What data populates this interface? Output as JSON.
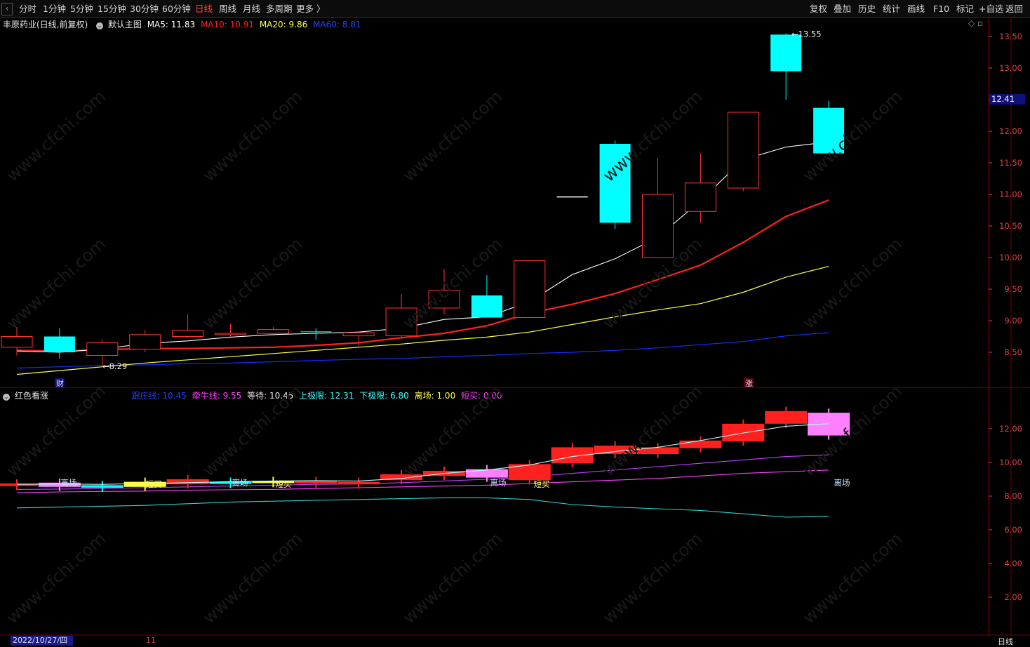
{
  "toolbar": {
    "periods": [
      "分时",
      "1分钟",
      "5分钟",
      "15分钟",
      "30分钟",
      "60分钟",
      "日线",
      "周线",
      "月线",
      "多周期",
      "更多 〉"
    ],
    "active_period": "日线",
    "right_buttons": [
      "复权",
      "叠加",
      "历史",
      "统计",
      "画线",
      "F10",
      "标记",
      "+自选",
      "返回"
    ]
  },
  "main_header": {
    "stock": "丰原药业(日线,前复权)",
    "template": "默认主图",
    "ma5": "MA5: 11.83",
    "ma10": "MA10: 10.91",
    "ma20": "MA20: 9.86",
    "ma60": "MA60: 8.81"
  },
  "sub_header": {
    "name": "红色看涨",
    "items": [
      "跟庄线: 10.45",
      "牵牛线: 9.55",
      "等待: 10.45",
      "上极限: 12.31",
      "下极限: 6.80",
      "离场: 1.00",
      "短买: 0.00"
    ]
  },
  "colors": {
    "up": "#ff3232",
    "down": "#00ffff",
    "ma5": "#ffffff",
    "ma10": "#ff2020",
    "ma20": "#ffff40",
    "ma60": "#1030ff",
    "grid": "#7a0000",
    "axis": "#e04040"
  },
  "main_axis_ticks": [
    "13.50",
    "13.00",
    "12.50",
    "12.00",
    "11.50",
    "11.00",
    "10.50",
    "10.00",
    "9.50",
    "9.00",
    "8.50"
  ],
  "sub_axis_ticks": [
    "12.00",
    "10.00",
    "8.00",
    "6.00",
    "4.00",
    "2.00"
  ],
  "price_tag": "12.41",
  "annotations": {
    "high": "13.55",
    "low": "8.29",
    "cai": "财",
    "zhang": "涨"
  },
  "sub_labels": {
    "lichang": "离场",
    "duanmai": "短买"
  },
  "footer": {
    "date": "2022/10/27/四",
    "mark": "11",
    "period": "日线"
  },
  "watermark": "www.cfchi.com",
  "chart_data": {
    "type": "candlestick",
    "candles": [
      {
        "o": 8.75,
        "h": 8.9,
        "l": 8.45,
        "c": 8.58,
        "u": true
      },
      {
        "o": 8.75,
        "h": 8.88,
        "l": 8.4,
        "c": 8.5,
        "u": false
      },
      {
        "o": 8.45,
        "h": 8.7,
        "l": 8.29,
        "c": 8.65,
        "u": true
      },
      {
        "o": 8.55,
        "h": 8.85,
        "l": 8.5,
        "c": 8.78,
        "u": true
      },
      {
        "o": 8.75,
        "h": 9.1,
        "l": 8.72,
        "c": 8.85,
        "u": true
      },
      {
        "o": 8.78,
        "h": 8.95,
        "l": 8.75,
        "c": 8.8,
        "u": true
      },
      {
        "o": 8.8,
        "h": 8.9,
        "l": 8.76,
        "c": 8.86,
        "u": true
      },
      {
        "o": 8.83,
        "h": 8.88,
        "l": 8.7,
        "c": 8.83,
        "u": false
      },
      {
        "o": 8.76,
        "h": 8.83,
        "l": 8.6,
        "c": 8.81,
        "u": true
      },
      {
        "o": 8.76,
        "h": 9.42,
        "l": 8.72,
        "c": 9.2,
        "u": true
      },
      {
        "o": 9.2,
        "h": 9.82,
        "l": 9.1,
        "c": 9.48,
        "u": true
      },
      {
        "o": 9.4,
        "h": 9.72,
        "l": 9.05,
        "c": 9.05,
        "u": false
      },
      {
        "o": 9.05,
        "h": 9.95,
        "l": 9.05,
        "c": 9.95,
        "u": true
      },
      {
        "o": 10.96,
        "h": 10.96,
        "l": 10.96,
        "c": 10.96,
        "u": true
      },
      {
        "o": 11.8,
        "h": 11.85,
        "l": 10.45,
        "c": 10.55,
        "u": false
      },
      {
        "o": 10.0,
        "h": 11.58,
        "l": 10.0,
        "c": 11.0,
        "u": true
      },
      {
        "o": 10.73,
        "h": 11.65,
        "l": 10.55,
        "c": 11.18,
        "u": true
      },
      {
        "o": 11.1,
        "h": 12.3,
        "l": 11.05,
        "c": 12.3,
        "u": true
      },
      {
        "o": 13.53,
        "h": 13.55,
        "l": 12.5,
        "c": 12.95,
        "u": false
      },
      {
        "o": 12.37,
        "h": 12.48,
        "l": 11.65,
        "c": 11.65,
        "u": false
      }
    ],
    "ma5": [
      8.52,
      8.5,
      8.55,
      8.64,
      8.68,
      8.74,
      8.78,
      8.8,
      8.82,
      8.88,
      9.02,
      9.06,
      9.3,
      9.73,
      9.98,
      10.32,
      10.9,
      11.55,
      11.75,
      11.83
    ],
    "ma10": [
      8.53,
      8.52,
      8.54,
      8.56,
      8.56,
      8.57,
      8.58,
      8.61,
      8.65,
      8.73,
      8.8,
      8.92,
      9.12,
      9.26,
      9.43,
      9.65,
      9.88,
      10.24,
      10.65,
      10.91
    ],
    "ma20": [
      8.15,
      8.21,
      8.27,
      8.33,
      8.38,
      8.43,
      8.48,
      8.53,
      8.58,
      8.63,
      8.69,
      8.74,
      8.82,
      8.94,
      9.06,
      9.17,
      9.27,
      9.45,
      9.69,
      9.86
    ],
    "ma60": [
      8.25,
      8.27,
      8.29,
      8.3,
      8.32,
      8.33,
      8.35,
      8.37,
      8.39,
      8.4,
      8.43,
      8.45,
      8.48,
      8.5,
      8.53,
      8.57,
      8.62,
      8.67,
      8.76,
      8.81
    ],
    "sub": {
      "genzhuang": [
        8.7,
        8.72,
        8.7,
        8.75,
        8.8,
        8.86,
        8.9,
        8.92,
        8.9,
        9.05,
        9.35,
        9.55,
        9.85,
        10.35,
        10.65,
        10.9,
        11.3,
        11.75,
        12.15,
        12.3
      ],
      "qianniu": [
        8.4,
        8.42,
        8.45,
        8.5,
        8.55,
        8.6,
        8.65,
        8.7,
        8.72,
        8.8,
        8.9,
        9.0,
        9.15,
        9.35,
        9.55,
        9.75,
        9.95,
        10.15,
        10.35,
        10.45
      ],
      "shangji": [
        8.2,
        8.25,
        8.28,
        8.3,
        8.35,
        8.38,
        8.4,
        8.45,
        8.5,
        8.55,
        8.6,
        8.65,
        8.75,
        8.85,
        8.95,
        9.05,
        9.2,
        9.35,
        9.45,
        9.55
      ],
      "xiaji": [
        7.3,
        7.35,
        7.4,
        7.45,
        7.55,
        7.65,
        7.7,
        7.75,
        7.8,
        7.85,
        7.9,
        7.9,
        7.8,
        7.5,
        7.35,
        7.25,
        7.15,
        6.95,
        6.75,
        6.8
      ],
      "bars": [
        {
          "t": 8.75,
          "b": 8.6,
          "c": "#ff2020"
        },
        {
          "t": 8.8,
          "b": 8.55,
          "c": "#ff80ff"
        },
        {
          "t": 8.65,
          "b": 8.5,
          "c": "#00ffff"
        },
        {
          "t": 8.85,
          "b": 8.55,
          "c": "#ffff40"
        },
        {
          "t": 9.0,
          "b": 8.7,
          "c": "#ff2020"
        },
        {
          "t": 8.85,
          "b": 8.8,
          "c": "#00ffff"
        },
        {
          "t": 8.9,
          "b": 8.8,
          "c": "#ffff40"
        },
        {
          "t": 8.9,
          "b": 8.75,
          "c": "#ff2020"
        },
        {
          "t": 8.85,
          "b": 8.7,
          "c": "#ff2020"
        },
        {
          "t": 9.3,
          "b": 8.95,
          "c": "#ff2020"
        },
        {
          "t": 9.5,
          "b": 9.2,
          "c": "#ff2020"
        },
        {
          "t": 9.6,
          "b": 9.1,
          "c": "#ff80ff"
        },
        {
          "t": 9.9,
          "b": 8.95,
          "c": "#ff2020"
        },
        {
          "t": 10.9,
          "b": 9.95,
          "c": "#ff2020"
        },
        {
          "t": 11.0,
          "b": 10.5,
          "c": "#ff2020"
        },
        {
          "t": 10.9,
          "b": 10.5,
          "c": "#ff2020"
        },
        {
          "t": 11.3,
          "b": 10.85,
          "c": "#ff2020"
        },
        {
          "t": 12.3,
          "b": 11.25,
          "c": "#ff2020"
        },
        {
          "t": 13.05,
          "b": 12.3,
          "c": "#ff2020"
        },
        {
          "t": 12.95,
          "b": 11.6,
          "c": "#ff80ff"
        }
      ]
    }
  }
}
